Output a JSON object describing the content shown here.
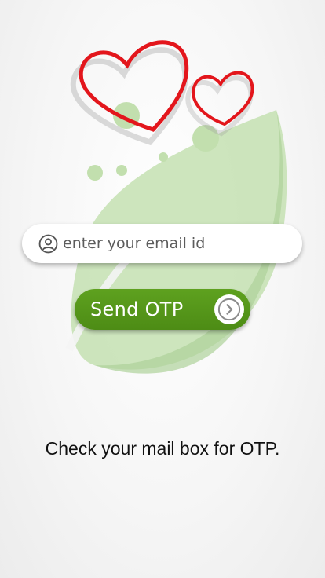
{
  "email": {
    "placeholder": "enter your email id",
    "icon": "user-circle-icon",
    "value": ""
  },
  "send_button": {
    "label": "Send OTP",
    "icon": "chevron-right-circle-icon"
  },
  "hint": {
    "text": "Check your mail box for OTP."
  },
  "colors": {
    "accent_green": "#55991a",
    "leaf_green": "#b8d9a4",
    "heart_red": "#e3161c"
  }
}
